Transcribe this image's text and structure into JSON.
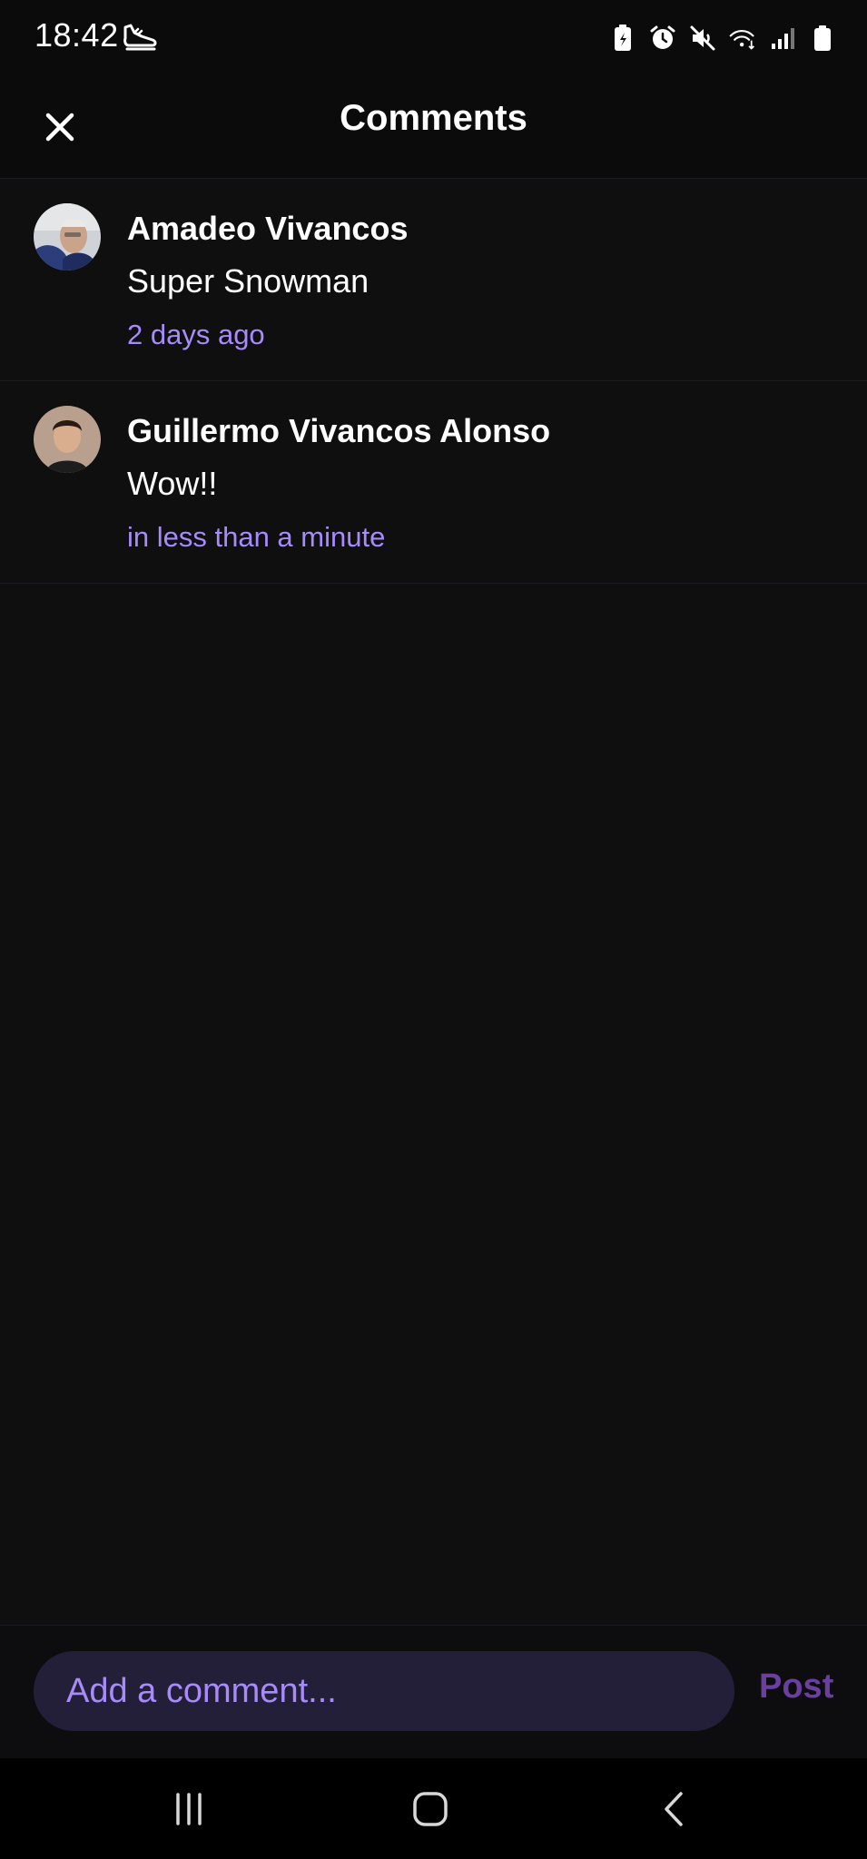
{
  "status_bar": {
    "time": "18:42",
    "left_icon": "shoe-icon",
    "right_icons": [
      "battery-saver-icon",
      "alarm-icon",
      "mute-icon",
      "wifi-icon",
      "signal-icon",
      "battery-icon"
    ]
  },
  "header": {
    "title": "Comments",
    "close_icon": "close-icon"
  },
  "comments": [
    {
      "author": "Amadeo Vivancos",
      "text": "Super Snowman",
      "time": "2 days ago"
    },
    {
      "author": "Guillermo Vivancos Alonso",
      "text": "Wow!!",
      "time": "in less than a minute"
    }
  ],
  "composer": {
    "placeholder": "Add a comment...",
    "value": "",
    "post_label": "Post"
  },
  "nav_bar": {
    "buttons": [
      "recent-apps-icon",
      "home-icon",
      "back-icon"
    ]
  },
  "colors": {
    "background": "#0f0f10",
    "accent": "#a78bfa",
    "input_bg": "#241f38",
    "post_label": "#6b3fa0"
  }
}
